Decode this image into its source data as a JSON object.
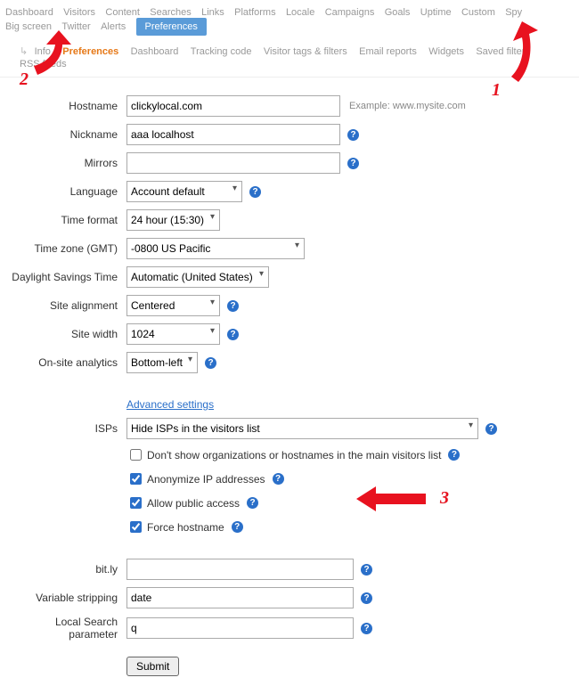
{
  "main_nav": {
    "items": [
      "Dashboard",
      "Visitors",
      "Content",
      "Searches",
      "Links",
      "Platforms",
      "Locale",
      "Campaigns",
      "Goals",
      "Uptime",
      "Custom",
      "Spy",
      "Big screen",
      "Twitter",
      "Alerts"
    ],
    "active": "Preferences"
  },
  "sub_nav": {
    "back_icon": "↳",
    "items_before": [
      "Info"
    ],
    "active": "Preferences",
    "items_after": [
      "Dashboard",
      "Tracking code",
      "Visitor tags & filters",
      "Email reports",
      "Widgets",
      "Saved filters",
      "RSS feeds"
    ]
  },
  "labels": {
    "hostname": "Hostname",
    "nickname": "Nickname",
    "mirrors": "Mirrors",
    "language": "Language",
    "timeformat": "Time format",
    "timezone": "Time zone (GMT)",
    "dst": "Daylight Savings Time",
    "alignment": "Site alignment",
    "width": "Site width",
    "onsite": "On-site analytics",
    "isps": "ISPs",
    "bitly": "bit.ly",
    "stripping": "Variable stripping",
    "search": "Local Search parameter"
  },
  "values": {
    "hostname": "clickylocal.com",
    "nickname": "aaa localhost",
    "mirrors": "",
    "language": "Account default",
    "timeformat": "24 hour (15:30)",
    "timezone": "-0800 US Pacific",
    "dst": "Automatic (United States)",
    "alignment": "Centered",
    "width": "1024",
    "onsite": "Bottom-left",
    "isps": "Hide ISPs in the visitors list",
    "bitly": "",
    "stripping": "date",
    "search": "q"
  },
  "example_hostname": "Example: www.mysite.com",
  "advanced_link": "Advanced settings",
  "checks": {
    "dont_show_org": "Don't show organizations or hostnames in the main visitors list",
    "anon": "Anonymize IP addresses",
    "public": "Allow public access",
    "force": "Force hostname"
  },
  "check_states": {
    "dont_show_org": false,
    "anon": true,
    "public": true,
    "force": true
  },
  "submit": "Submit",
  "help_icon": "?",
  "annotations": {
    "one": "1",
    "two": "2",
    "three": "3"
  }
}
